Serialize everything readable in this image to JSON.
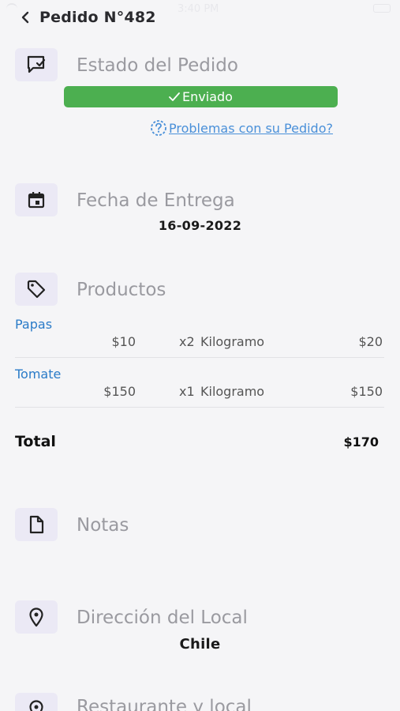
{
  "status_bar": {
    "time": "3:40 PM"
  },
  "nav": {
    "title": "Pedido N°482"
  },
  "status_section": {
    "title": "Estado del Pedido",
    "status": "Enviado",
    "status_color": "#4caf50",
    "problems_link": "Problemas con su Pedido?",
    "icon": "chat-check-icon"
  },
  "delivery_section": {
    "title": "Fecha de Entrega",
    "date": "16-09-2022",
    "icon": "calendar-icon"
  },
  "products_section": {
    "title": "Productos",
    "icon": "tag-icon",
    "items": [
      {
        "name": "Papas",
        "price": "$10",
        "qty": "x2",
        "unit": "Kilogramo",
        "subtotal": "$20"
      },
      {
        "name": "Tomate",
        "price": "$150",
        "qty": "x1",
        "unit": "Kilogramo",
        "subtotal": "$150"
      }
    ],
    "total_label": "Total",
    "total_value": "$170"
  },
  "notes_section": {
    "title": "Notas",
    "icon": "document-icon"
  },
  "address_section": {
    "title": "Dirección del Local",
    "value": "Chile",
    "icon": "location-pin-icon"
  },
  "restaurant_section": {
    "title": "Restaurante y local",
    "icon": "location-pin-icon"
  },
  "colors": {
    "accent_link": "#4a90d9",
    "product_name": "#2a7bc8",
    "icon_bg": "#ebe9f5"
  }
}
